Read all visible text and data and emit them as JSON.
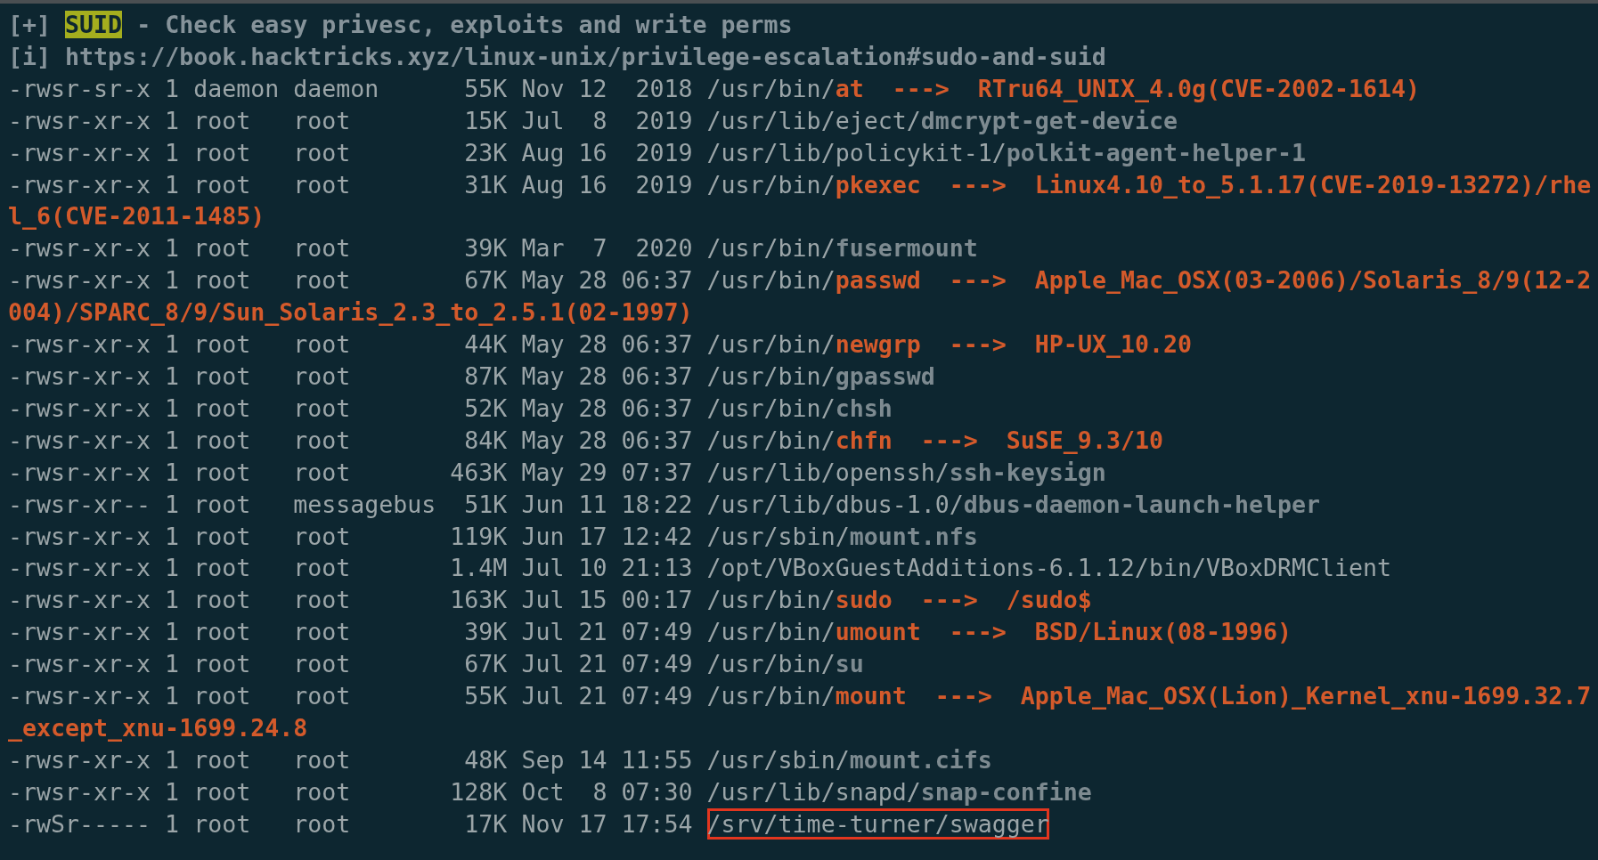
{
  "section": {
    "marker": "[+]",
    "tag": "SUID",
    "title": "- Check easy privesc, exploits and write perms"
  },
  "reference": {
    "marker": "[i]",
    "url": "https://book.hacktricks.xyz/linux-unix/privilege-escalation#sudo-and-suid"
  },
  "files": [
    {
      "info": "-rwsr-sr-x 1 daemon daemon      55K Nov 12  2018",
      "dir": "/usr/bin/",
      "file": "at",
      "kind": "vulnerable",
      "arrow": "--->",
      "note": "RTru64_UNIX_4.0g(CVE-2002-1614)",
      "boxed": false
    },
    {
      "info": "-rwsr-xr-x 1 root   root        15K Jul  8  2019",
      "dir": "/usr/lib/eject/",
      "file": "dmcrypt-get-device",
      "kind": "normal",
      "boxed": false
    },
    {
      "info": "-rwsr-xr-x 1 root   root        23K Aug 16  2019",
      "dir": "/usr/lib/policykit-1/",
      "file": "polkit-agent-helper-1",
      "kind": "normal",
      "boxed": false
    },
    {
      "info": "-rwsr-xr-x 1 root   root        31K Aug 16  2019",
      "dir": "/usr/bin/",
      "file": "pkexec",
      "kind": "vulnerable",
      "arrow": "--->",
      "note": "Linux4.10_to_5.1.17(CVE-2019-13272)/rhe",
      "note_wrapped": "l_6(CVE-2011-1485)",
      "boxed": false
    },
    {
      "info": "-rwsr-xr-x 1 root   root        39K Mar  7  2020",
      "dir": "/usr/bin/",
      "file": "fusermount",
      "kind": "normal",
      "boxed": false
    },
    {
      "info": "-rwsr-xr-x 1 root   root        67K May 28 06:37",
      "dir": "/usr/bin/",
      "file": "passwd",
      "kind": "vulnerable",
      "arrow": "--->",
      "note": "Apple_Mac_OSX(03-2006)/Solaris_8/9(12-2",
      "note_wrapped": "004)/SPARC_8/9/Sun_Solaris_2.3_to_2.5.1(02-1997)",
      "boxed": false
    },
    {
      "info": "-rwsr-xr-x 1 root   root        44K May 28 06:37",
      "dir": "/usr/bin/",
      "file": "newgrp",
      "kind": "vulnerable",
      "arrow": "--->",
      "note": "HP-UX_10.20",
      "boxed": false
    },
    {
      "info": "-rwsr-xr-x 1 root   root        87K May 28 06:37",
      "dir": "/usr/bin/",
      "file": "gpasswd",
      "kind": "normal",
      "boxed": false
    },
    {
      "info": "-rwsr-xr-x 1 root   root        52K May 28 06:37",
      "dir": "/usr/bin/",
      "file": "chsh",
      "kind": "normal",
      "boxed": false
    },
    {
      "info": "-rwsr-xr-x 1 root   root        84K May 28 06:37",
      "dir": "/usr/bin/",
      "file": "chfn",
      "kind": "vulnerable",
      "arrow": "--->",
      "note": "SuSE_9.3/10",
      "boxed": false
    },
    {
      "info": "-rwsr-xr-x 1 root   root       463K May 29 07:37",
      "dir": "/usr/lib/openssh/",
      "file": "ssh-keysign",
      "kind": "normal",
      "boxed": false
    },
    {
      "info": "-rwsr-xr-- 1 root   messagebus  51K Jun 11 18:22",
      "dir": "/usr/lib/dbus-1.0/",
      "file": "dbus-daemon-launch-helper",
      "kind": "normal",
      "boxed": false
    },
    {
      "info": "-rwsr-xr-x 1 root   root       119K Jun 17 12:42",
      "dir": "/usr/sbin/",
      "file": "mount.nfs",
      "kind": "normal",
      "boxed": false
    },
    {
      "info": "-rwsr-xr-x 1 root   root       1.4M Jul 10 21:13",
      "dir": "/opt/VBoxGuestAdditions-6.1.12/bin/VBoxDRMClient",
      "kind": "plain",
      "boxed": false
    },
    {
      "info": "-rwsr-xr-x 1 root   root       163K Jul 15 00:17",
      "dir": "/usr/bin/",
      "file": "sudo",
      "kind": "vulnerable",
      "arrow": "--->",
      "note": "/sudo$",
      "boxed": false
    },
    {
      "info": "-rwsr-xr-x 1 root   root        39K Jul 21 07:49",
      "dir": "/usr/bin/",
      "file": "umount",
      "kind": "vulnerable",
      "arrow": "--->",
      "note": "BSD/Linux(08-1996)",
      "boxed": false
    },
    {
      "info": "-rwsr-xr-x 1 root   root        67K Jul 21 07:49",
      "dir": "/usr/bin/",
      "file": "su",
      "kind": "normal",
      "boxed": false
    },
    {
      "info": "-rwsr-xr-x 1 root   root        55K Jul 21 07:49",
      "dir": "/usr/bin/",
      "file": "mount",
      "kind": "vulnerable",
      "arrow": "--->",
      "note": "Apple_Mac_OSX(Lion)_Kernel_xnu-1699.32.7",
      "note_wrapped": "_except_xnu-1699.24.8",
      "boxed": false
    },
    {
      "info": "-rwsr-xr-x 1 root   root        48K Sep 14 11:55",
      "dir": "/usr/sbin/",
      "file": "mount.cifs",
      "kind": "normal",
      "boxed": false
    },
    {
      "info": "-rwsr-xr-x 1 root   root       128K Oct  8 07:30",
      "dir": "/usr/lib/snapd/",
      "file": "snap-confine",
      "kind": "normal",
      "boxed": false
    },
    {
      "info": "-rwSr----- 1 root   root        17K Nov 17 17:54",
      "dir": "/srv/time-turner/swagger",
      "kind": "plain",
      "boxed": true
    }
  ]
}
